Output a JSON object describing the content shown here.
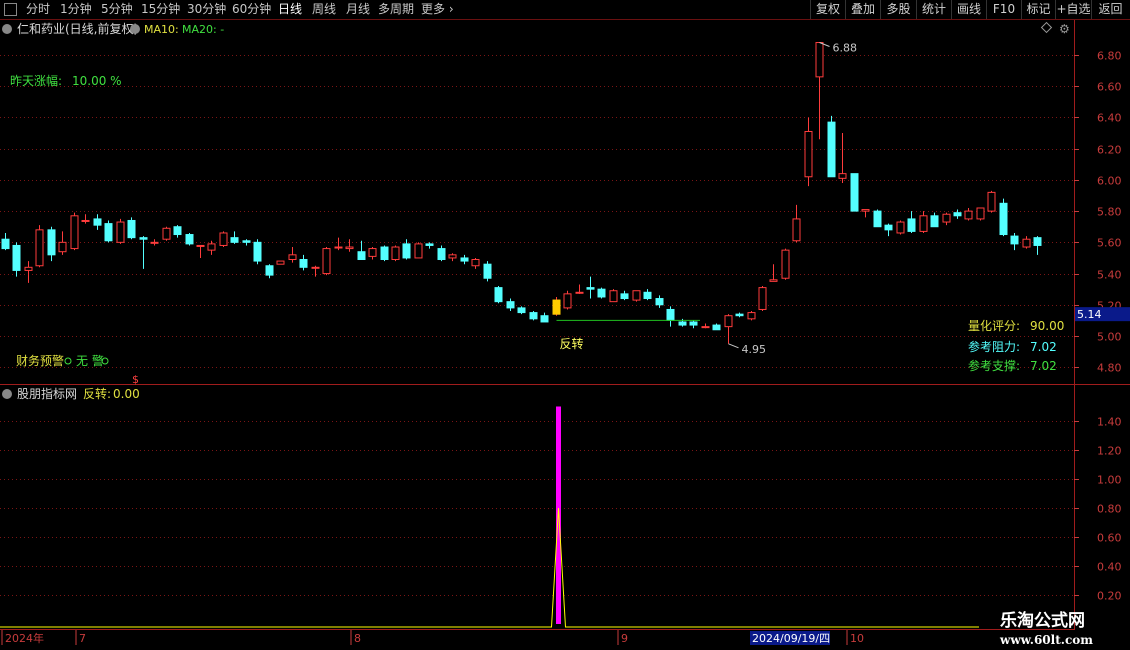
{
  "toolbar": {
    "periods": [
      "分时",
      "1分钟",
      "5分钟",
      "15分钟",
      "30分钟",
      "60分钟",
      "日线",
      "周线",
      "月线",
      "多周期",
      "更多"
    ],
    "active": "日线",
    "right_buttons": [
      "复权",
      "叠加",
      "多股",
      "统计",
      "画线",
      "F10",
      "标记",
      "+自选",
      "返回"
    ]
  },
  "main_panel": {
    "title": "仁和药业(日线,前复权)",
    "ma10": "MA10:",
    "ma20": "MA20: -",
    "prev_change_label": "昨天涨幅:",
    "prev_change_value": "10.00 %",
    "finance_label": "财务预警",
    "finance_value": "无 警",
    "reversal_label": "反转",
    "score_label": "量化评分:",
    "score_value": "90.00",
    "resist_label": "参考阻力:",
    "resist_value": "7.02",
    "support_label": "参考支撑:",
    "support_value": "7.02"
  },
  "sub_panel": {
    "title": "股朋指标网",
    "indicator_label": "反转:",
    "indicator_value": "0.00"
  },
  "axis": {
    "date_labels": [
      "2024年",
      "7",
      "8",
      "9",
      "10"
    ],
    "crosshair_date": "2024/09/19/四"
  },
  "watermark": {
    "title": "乐淘公式网",
    "url": "www.60lt.com"
  },
  "colors": {
    "up": "#ff3c3c",
    "down": "#54ffff",
    "grid": "#7a1515",
    "axis_text": "#c83c3c",
    "signal_bar": "#ff00ff",
    "signal_line": "#ffff00"
  },
  "chart_data": {
    "type": "candlestick",
    "y_main": {
      "ticks": [
        "6.80",
        "6.60",
        "6.40",
        "6.20",
        "6.00",
        "5.80",
        "5.60",
        "5.40",
        "5.20",
        "5.00",
        "4.80"
      ],
      "range": [
        4.72,
        7.0
      ]
    },
    "y_sub": {
      "ticks": [
        "1.40",
        "1.20",
        "1.00",
        "0.80",
        "0.60",
        "0.40",
        "0.20"
      ],
      "range": [
        0,
        1.55
      ]
    },
    "current_price": "5.14",
    "high_label": "6.88",
    "low_label": "4.95",
    "candles": [
      [
        5.62,
        5.66,
        5.55,
        5.56
      ],
      [
        5.58,
        5.6,
        5.38,
        5.42
      ],
      [
        5.42,
        5.48,
        5.34,
        5.44
      ],
      [
        5.45,
        5.71,
        5.44,
        5.68
      ],
      [
        5.68,
        5.7,
        5.48,
        5.52
      ],
      [
        5.54,
        5.67,
        5.52,
        5.6
      ],
      [
        5.56,
        5.79,
        5.55,
        5.77
      ],
      [
        5.74,
        5.78,
        5.72,
        5.74
      ],
      [
        5.75,
        5.78,
        5.68,
        5.71
      ],
      [
        5.72,
        5.74,
        5.6,
        5.61
      ],
      [
        5.6,
        5.75,
        5.59,
        5.73
      ],
      [
        5.74,
        5.76,
        5.62,
        5.63
      ],
      [
        5.63,
        5.64,
        5.43,
        5.62
      ],
      [
        5.6,
        5.62,
        5.58,
        5.6
      ],
      [
        5.62,
        5.7,
        5.61,
        5.69
      ],
      [
        5.7,
        5.71,
        5.63,
        5.65
      ],
      [
        5.65,
        5.66,
        5.58,
        5.59
      ],
      [
        5.58,
        5.58,
        5.5,
        5.58
      ],
      [
        5.55,
        5.61,
        5.52,
        5.59
      ],
      [
        5.58,
        5.67,
        5.57,
        5.66
      ],
      [
        5.63,
        5.67,
        5.59,
        5.6
      ],
      [
        5.61,
        5.62,
        5.58,
        5.6
      ],
      [
        5.6,
        5.62,
        5.46,
        5.48
      ],
      [
        5.45,
        5.46,
        5.37,
        5.39
      ],
      [
        5.46,
        5.48,
        5.46,
        5.48
      ],
      [
        5.49,
        5.57,
        5.47,
        5.52
      ],
      [
        5.49,
        5.52,
        5.42,
        5.44
      ],
      [
        5.44,
        5.45,
        5.38,
        5.44
      ],
      [
        5.4,
        5.57,
        5.39,
        5.56
      ],
      [
        5.57,
        5.63,
        5.55,
        5.57
      ],
      [
        5.56,
        5.62,
        5.54,
        5.57
      ],
      [
        5.54,
        5.61,
        5.49,
        5.49
      ],
      [
        5.51,
        5.57,
        5.49,
        5.56
      ],
      [
        5.57,
        5.58,
        5.48,
        5.49
      ],
      [
        5.49,
        5.58,
        5.48,
        5.57
      ],
      [
        5.59,
        5.62,
        5.49,
        5.5
      ],
      [
        5.5,
        5.6,
        5.5,
        5.59
      ],
      [
        5.59,
        5.6,
        5.56,
        5.58
      ],
      [
        5.56,
        5.58,
        5.48,
        5.49
      ],
      [
        5.5,
        5.53,
        5.48,
        5.52
      ],
      [
        5.5,
        5.52,
        5.46,
        5.48
      ],
      [
        5.45,
        5.5,
        5.43,
        5.49
      ],
      [
        5.46,
        5.48,
        5.35,
        5.37
      ],
      [
        5.31,
        5.32,
        5.21,
        5.22
      ],
      [
        5.22,
        5.24,
        5.16,
        5.18
      ],
      [
        5.18,
        5.19,
        5.14,
        5.15
      ],
      [
        5.15,
        5.16,
        5.1,
        5.11
      ],
      [
        5.13,
        5.15,
        5.09,
        5.09
      ],
      [
        5.14,
        5.25,
        5.13,
        5.23
      ],
      [
        5.18,
        5.29,
        5.17,
        5.27
      ],
      [
        5.28,
        5.33,
        5.27,
        5.28
      ],
      [
        5.31,
        5.38,
        5.24,
        5.3
      ],
      [
        5.3,
        5.31,
        5.24,
        5.25
      ],
      [
        5.22,
        5.3,
        5.22,
        5.29
      ],
      [
        5.27,
        5.29,
        5.23,
        5.24
      ],
      [
        5.23,
        5.29,
        5.22,
        5.29
      ],
      [
        5.28,
        5.3,
        5.23,
        5.24
      ],
      [
        5.24,
        5.26,
        5.18,
        5.2
      ],
      [
        5.17,
        5.19,
        5.06,
        5.1
      ],
      [
        5.09,
        5.11,
        5.06,
        5.07
      ],
      [
        5.09,
        5.1,
        5.05,
        5.07
      ],
      [
        5.06,
        5.08,
        5.05,
        5.06
      ],
      [
        5.07,
        5.08,
        5.04,
        5.04
      ],
      [
        5.06,
        5.14,
        4.95,
        5.13
      ],
      [
        5.14,
        5.15,
        5.12,
        5.13
      ],
      [
        5.11,
        5.16,
        5.1,
        5.15
      ],
      [
        5.17,
        5.32,
        5.16,
        5.31
      ],
      [
        5.35,
        5.46,
        5.35,
        5.36
      ],
      [
        5.37,
        5.56,
        5.36,
        5.55
      ],
      [
        5.61,
        5.84,
        5.6,
        5.75
      ],
      [
        6.02,
        6.4,
        5.96,
        6.31
      ],
      [
        6.66,
        6.88,
        6.26,
        6.88
      ],
      [
        6.37,
        6.41,
        6.02,
        6.02
      ],
      [
        6.01,
        6.3,
        5.98,
        6.04
      ],
      [
        6.04,
        6.04,
        5.8,
        5.8
      ],
      [
        5.8,
        5.81,
        5.76,
        5.81
      ],
      [
        5.8,
        5.81,
        5.7,
        5.7
      ],
      [
        5.71,
        5.72,
        5.64,
        5.68
      ],
      [
        5.66,
        5.74,
        5.65,
        5.73
      ],
      [
        5.75,
        5.8,
        5.66,
        5.67
      ],
      [
        5.67,
        5.8,
        5.66,
        5.77
      ],
      [
        5.77,
        5.79,
        5.7,
        5.7
      ],
      [
        5.73,
        5.79,
        5.71,
        5.78
      ],
      [
        5.79,
        5.81,
        5.75,
        5.77
      ],
      [
        5.75,
        5.82,
        5.74,
        5.8
      ],
      [
        5.75,
        5.82,
        5.74,
        5.82
      ],
      [
        5.8,
        5.93,
        5.79,
        5.92
      ],
      [
        5.85,
        5.88,
        5.64,
        5.65
      ],
      [
        5.64,
        5.66,
        5.55,
        5.59
      ],
      [
        5.57,
        5.64,
        5.56,
        5.62
      ],
      [
        5.63,
        5.64,
        5.52,
        5.58
      ]
    ],
    "signal_index": 48,
    "signal_value": 1.5,
    "signal_line_peak": 0.8,
    "support_line_price": 5.1
  }
}
